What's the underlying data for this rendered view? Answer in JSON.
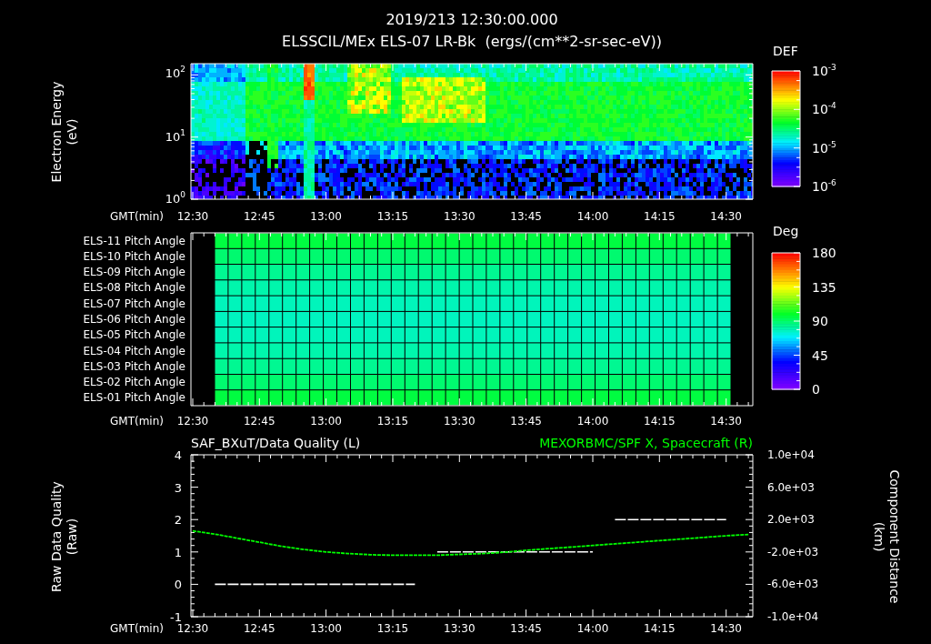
{
  "header": {
    "title": "2019/213 12:30:00.000",
    "subtitle": "ELSSCIL/MEx ELS-07 LR-Bk  (ergs/(cm**2-sr-sec-eV))"
  },
  "spectrogram_panel": {
    "y_label_lines": [
      "Electron Energy",
      "(eV)"
    ],
    "y_ticks": [
      {
        "base": "10",
        "exponent": "2"
      },
      {
        "base": "10",
        "exponent": "1"
      },
      {
        "base": "10",
        "exponent": "0"
      }
    ],
    "colorbar": {
      "title": "DEF",
      "ticks": [
        {
          "base": "10",
          "exponent": "-3"
        },
        {
          "base": "10",
          "exponent": "-4"
        },
        {
          "base": "10",
          "exponent": "-5"
        },
        {
          "base": "10",
          "exponent": "-6"
        }
      ]
    },
    "x_axis_label": "GMT(min)",
    "x_ticks": [
      "12:30",
      "12:45",
      "13:00",
      "13:15",
      "13:30",
      "13:45",
      "14:00",
      "14:15",
      "14:30"
    ]
  },
  "pitch_angle_panel": {
    "row_labels": [
      "ELS-11 Pitch Angle",
      "ELS-10 Pitch Angle",
      "ELS-09 Pitch Angle",
      "ELS-08 Pitch Angle",
      "ELS-07 Pitch Angle",
      "ELS-06 Pitch Angle",
      "ELS-05 Pitch Angle",
      "ELS-04 Pitch Angle",
      "ELS-03 Pitch Angle",
      "ELS-02 Pitch Angle",
      "ELS-01 Pitch Angle"
    ],
    "colorbar": {
      "title": "Deg",
      "ticks": [
        "180",
        "135",
        "90",
        "45",
        "0"
      ]
    },
    "x_axis_label": "GMT(min)",
    "x_ticks": [
      "12:30",
      "12:45",
      "13:00",
      "13:15",
      "13:30",
      "13:45",
      "14:00",
      "14:15",
      "14:30"
    ]
  },
  "data_quality_panel": {
    "y_label_lines": [
      "Raw Data Quality",
      "(Raw)"
    ],
    "right_label_lines": [
      "Component Distance",
      "(km)"
    ],
    "left_title_tag": "(L)",
    "right_title_tag": "(R)",
    "x_axis_label": "GMT(min)",
    "chart_data": {
      "type": "line",
      "ylim": [
        -1,
        4
      ],
      "yticks": [
        -1,
        0,
        1,
        2,
        3,
        4
      ],
      "categories": [
        "12:30",
        null,
        null,
        "12:45",
        null,
        null,
        "13:00",
        null,
        null,
        "13:15",
        null,
        null,
        "13:30",
        null,
        null,
        "13:45",
        null,
        null,
        "14:00",
        null,
        null,
        "14:15",
        null,
        null,
        "14:30",
        null
      ],
      "series": [
        {
          "name": "SAF_BXuT/Data Quality",
          "color": "#ffffff",
          "line_style": "dashed",
          "values": [
            null,
            0,
            0,
            0,
            0,
            0,
            0,
            0,
            0,
            0,
            0,
            1,
            1,
            1,
            1,
            1,
            1,
            1,
            1,
            2,
            2,
            2,
            2,
            2,
            2,
            null
          ]
        }
      ]
    },
    "right_axis": {
      "chart_data": {
        "type": "line",
        "ylim": [
          -10000,
          10000
        ],
        "yticks": [
          {
            "value": 10000,
            "label": "1.0e+04"
          },
          {
            "value": 6000,
            "label": "6.0e+03"
          },
          {
            "value": 2000,
            "label": "2.0e+03"
          },
          {
            "value": -2000,
            "label": "-2.0e+03"
          },
          {
            "value": -6000,
            "label": "-6.0e+03"
          },
          {
            "value": -10000,
            "label": "-1.0e+04"
          }
        ],
        "series": [
          {
            "name": "MEXORBMC/SPF X, Spacecraft",
            "color": "#00ff00",
            "line_style": "dashed",
            "values": [
              600,
              200,
              -300,
              -800,
              -1300,
              -1700,
              -2000,
              -2200,
              -2350,
              -2400,
              -2400,
              -2400,
              -2300,
              -2200,
              -2050,
              -1800,
              -1600,
              -1400,
              -1200,
              -1000,
              -800,
              -600,
              -400,
              -200,
              0,
              150
            ]
          }
        ]
      }
    }
  }
}
